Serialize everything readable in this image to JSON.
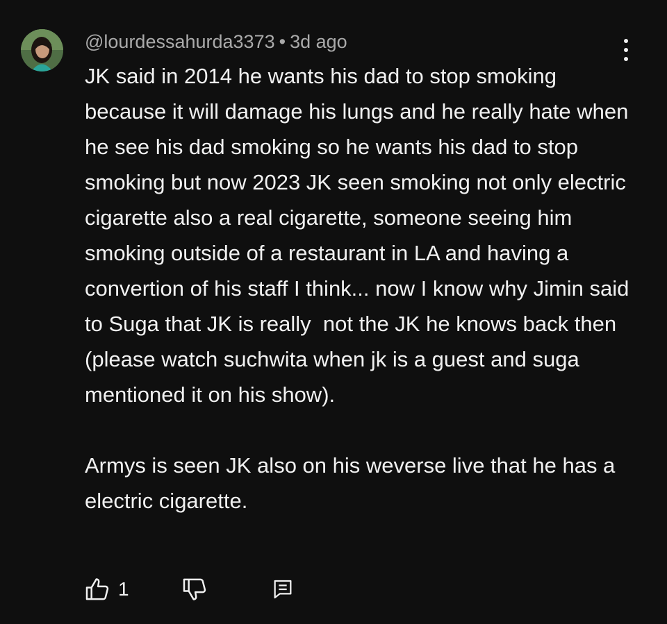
{
  "comment": {
    "author": "@lourdessahurda3373",
    "separator": "•",
    "timestamp": "3d ago",
    "paragraphs": [
      "JK said in 2014 he wants his dad to stop smoking because it will damage his lungs and he really hate when he see his dad smoking so he wants his dad to stop smoking but now 2023 JK seen smoking not only electric cigarette also a real cigarette, someone seeing him smoking outside of a restaurant in LA and having a convertion of his staff I think... now I know why Jimin said to Suga that JK is really  not the JK he knows back then (please watch suchwita when jk is a guest and suga mentioned it on his show).",
      "Armys is seen JK also on his weverse live that he has a electric cigarette."
    ],
    "like_count": "1"
  },
  "icons": {
    "menu": "more-vert-icon",
    "like": "thumb-up-icon",
    "dislike": "thumb-down-icon",
    "reply": "comment-icon"
  },
  "colors": {
    "background": "#0f0f0f",
    "text": "#f1f1f1",
    "secondary_text": "#aaaaaa"
  }
}
